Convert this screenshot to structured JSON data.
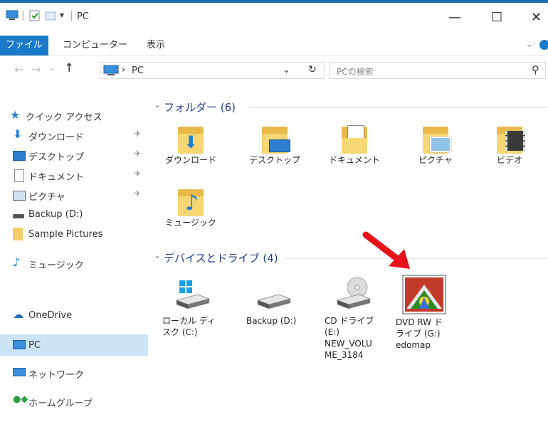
{
  "window": {
    "title": "PC",
    "minimize": "—",
    "maximize": "☐",
    "close": "✕"
  },
  "ribbon": {
    "tabs": [
      "ファイル",
      "コンピューター",
      "表示"
    ],
    "expand": "⌄"
  },
  "address": {
    "back": "←",
    "forward": "→",
    "recent": "⌄",
    "up": "↑",
    "path_sep": "›",
    "path": "PC",
    "dropdown": "⌄",
    "refresh": "↻",
    "search_placeholder": "PCの検索",
    "search_icon": "⚲"
  },
  "nav": {
    "quick_access": "クイック アクセス",
    "items": [
      {
        "label": "ダウンロード",
        "pinned": true
      },
      {
        "label": "デスクトップ",
        "pinned": true
      },
      {
        "label": "ドキュメント",
        "pinned": true
      },
      {
        "label": "ピクチャ",
        "pinned": true
      },
      {
        "label": "Backup (D:)",
        "pinned": false
      },
      {
        "label": "Sample Pictures",
        "pinned": false
      },
      {
        "label": "ミュージック",
        "pinned": false
      }
    ],
    "onedrive": "OneDrive",
    "pc": "PC",
    "network": "ネットワーク",
    "homegroup": "ホームグループ",
    "pin_icon": "✈"
  },
  "folders": {
    "header": "フォルダー (6)",
    "items": [
      "ダウンロード",
      "デスクトップ",
      "ドキュメント",
      "ピクチャ",
      "ビデオ",
      "ミュージック"
    ]
  },
  "devices": {
    "header": "デバイスとドライブ (4)",
    "items": [
      {
        "line1": "ローカル ディ",
        "line2": "スク (C:)",
        "line3": "",
        "line4": ""
      },
      {
        "line1": "Backup (D:)",
        "line2": "",
        "line3": "",
        "line4": ""
      },
      {
        "line1": "CD ドライブ",
        "line2": "(E:)",
        "line3": "NEW_VOLU",
        "line4": "ME_3184"
      },
      {
        "line1": "DVD RW ド",
        "line2": "ライブ (G:)",
        "line3": "edomap",
        "line4": ""
      }
    ]
  },
  "colors": {
    "accent": "#1979ca",
    "header_text": "#1e3f8a",
    "selected_nav": "#cce4f7",
    "arrow": "#e8121a"
  }
}
